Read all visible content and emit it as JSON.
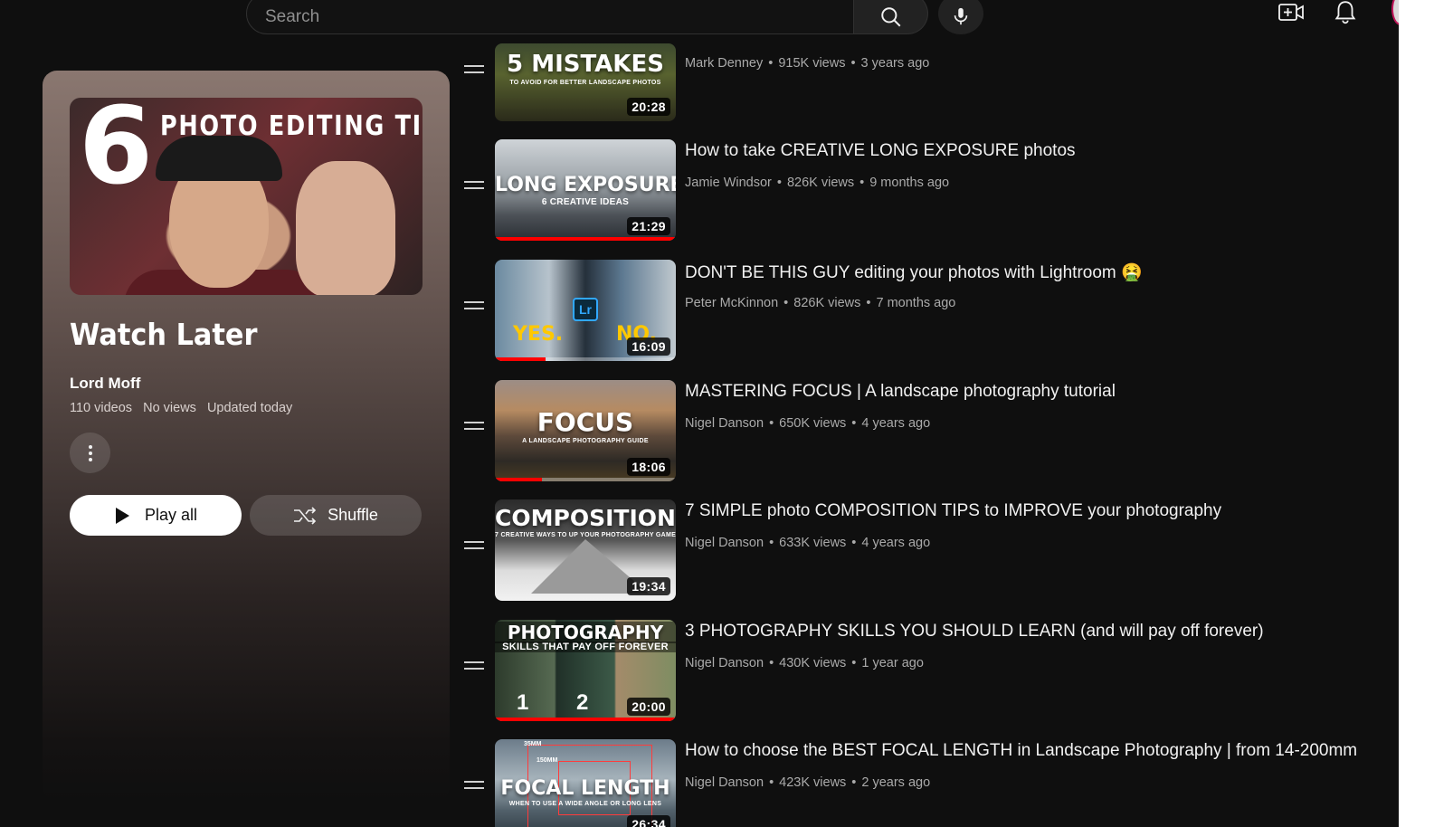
{
  "search": {
    "placeholder": "Search"
  },
  "header": {
    "icons": [
      "search-icon",
      "microphone-icon",
      "create-video-icon",
      "bell-icon",
      "avatar"
    ]
  },
  "playlist": {
    "thumbnail": {
      "big_number": "6",
      "headline": "PHOTO EDITING TIPS"
    },
    "title": "Watch Later",
    "owner": "Lord Moff",
    "video_count": "110 videos",
    "views": "No views",
    "updated": "Updated today",
    "play_all_label": "Play all",
    "shuffle_label": "Shuffle"
  },
  "videos": [
    {
      "thumb_text": "5 MISTAKES",
      "thumb_sub": "TO AVOID FOR BETTER LANDSCAPE PHOTOS",
      "title": "",
      "channel": "Mark Denney",
      "views": "915K views",
      "age": "3 years ago",
      "duration": "20:28",
      "progress": 0
    },
    {
      "thumb_text": "LONG EXPOSURE",
      "thumb_sub": "6 CREATIVE IDEAS",
      "title": "How to take CREATIVE LONG EXPOSURE photos",
      "channel": "Jamie Windsor",
      "views": "826K views",
      "age": "9 months ago",
      "duration": "21:29",
      "progress": 1.0
    },
    {
      "thumb_text": "Lr",
      "thumb_left_label": "YES.",
      "thumb_right_label": "NO.",
      "title": "DON'T BE THIS GUY editing your photos with Lightroom 🤮",
      "channel": "Peter McKinnon",
      "views": "826K views",
      "age": "7 months ago",
      "duration": "16:09",
      "progress": 0.28
    },
    {
      "thumb_text": "FOCUS",
      "thumb_sub": "A LANDSCAPE PHOTOGRAPHY GUIDE",
      "title": "MASTERING FOCUS | A landscape photography tutorial",
      "channel": "Nigel Danson",
      "views": "650K views",
      "age": "4 years ago",
      "duration": "18:06",
      "progress": 0.26
    },
    {
      "thumb_text": "COMPOSITION",
      "thumb_sub": "7 CREATIVE WAYS TO UP YOUR PHOTOGRAPHY GAME",
      "title": "7 SIMPLE photo COMPOSITION TIPS to IMPROVE your photography",
      "channel": "Nigel Danson",
      "views": "633K views",
      "age": "4 years ago",
      "duration": "19:34",
      "progress": 0
    },
    {
      "thumb_text": "PHOTOGRAPHY",
      "thumb_sub": "SKILLS THAT PAY OFF FOREVER",
      "thumb_num_1": "1",
      "thumb_num_2": "2",
      "title": "3 PHOTOGRAPHY SKILLS YOU SHOULD LEARN (and will pay off forever)",
      "channel": "Nigel Danson",
      "views": "430K views",
      "age": "1 year ago",
      "duration": "20:00",
      "progress": 1.0
    },
    {
      "thumb_text": "FOCAL LENGTH",
      "thumb_sub": "WHEN TO USE A WIDE ANGLE OR LONG LENS",
      "thumb_tag_1": "35MM",
      "thumb_tag_2": "150MM",
      "title": "How to choose the BEST FOCAL LENGTH in Landscape Photography | from 14-200mm",
      "channel": "Nigel Danson",
      "views": "423K views",
      "age": "2 years ago",
      "duration": "26:34",
      "progress": 0
    }
  ],
  "colors": {
    "background": "#0f0f0f",
    "progress": "#ff0000",
    "meta_text": "#aaaaaa"
  }
}
